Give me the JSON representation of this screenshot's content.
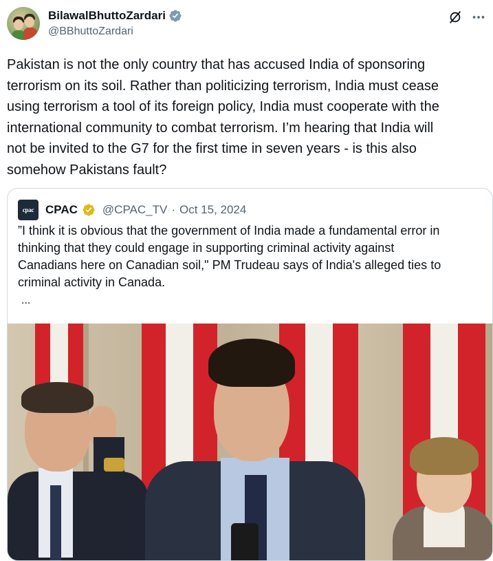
{
  "author": {
    "display_name": "BilawalBhuttoZardari",
    "handle": "@BBhuttoZardari",
    "verified_color": "#829aab"
  },
  "tweet": {
    "text": "Pakistan is not the only country that has accused India of sponsoring\nterrorism on its soil. Rather than politicizing terrorism, India must cease\nusing terrorism a tool of its foreign policy, India must cooperate with the\ninternational community to combat terrorism. I’m hearing that India will\nnot be invited to the G7 for the first time in seven years - is this also\nsomehow Pakistans fault?"
  },
  "quote": {
    "logo_text": "cpac",
    "name": "CPAC",
    "handle": "@CPAC_TV",
    "separator": "·",
    "date": "Oct 15, 2024",
    "text": "”I think it is obvious that the government of India made a fundamental error in\nthinking that they could engage in supporting criminal activity against\nCanadians here on Canadian soil,\" PM Trudeau says of India's alleged ties to\ncriminal activity in Canada.",
    "ellipsis": "...",
    "badge_color": "#e2b719"
  },
  "icons": {
    "verified": "verified-badge-icon",
    "grok": "grok-icon",
    "more": "more-icon",
    "gold_badge": "gold-verified-icon"
  },
  "colors": {
    "text": "#0f1419",
    "secondary": "#536471",
    "border": "#cfd9de",
    "flag_red": "#d2232a"
  }
}
